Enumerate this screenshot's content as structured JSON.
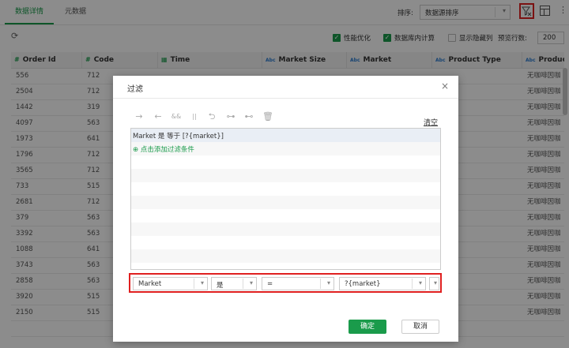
{
  "tabs": [
    {
      "label": "数据详情"
    },
    {
      "label": "元数据"
    }
  ],
  "sort": {
    "label": "排序:",
    "value": "数据源排序"
  },
  "icons": {
    "filter": "filter-icon",
    "layout": "layout-icon",
    "more": "more-icon",
    "refresh": "refresh-icon",
    "close": "close-icon"
  },
  "colors": {
    "accent": "#1a9b4b",
    "highlight": "#e02020",
    "overlay": "rgba(0,0,0,0.45)"
  },
  "options": {
    "perf": {
      "label": "性能优化",
      "checked": true
    },
    "db_calc": {
      "label": "数据库内计算",
      "checked": true
    },
    "show_hidden": {
      "label": "显示隐藏列",
      "checked": false
    },
    "preview_label": "预览行数:",
    "preview_value": "200"
  },
  "table": {
    "columns": [
      {
        "type": "#",
        "name": "Order Id"
      },
      {
        "type": "#",
        "name": "Code"
      },
      {
        "type": "time",
        "name": "Time"
      },
      {
        "type": "Abc",
        "name": "Market Size"
      },
      {
        "type": "Abc",
        "name": "Market"
      },
      {
        "type": "Abc",
        "name": "Product Type"
      },
      {
        "type": "Abc",
        "name": "Product"
      }
    ],
    "rows": [
      [
        "556",
        "712",
        "",
        "",
        "",
        "",
        "无咖啡因咖"
      ],
      [
        "2504",
        "712",
        "",
        "",
        "",
        "",
        "无咖啡因咖"
      ],
      [
        "1442",
        "319",
        "",
        "",
        "",
        "",
        "无咖啡因咖"
      ],
      [
        "4097",
        "563",
        "",
        "",
        "",
        "",
        "无咖啡因咖"
      ],
      [
        "1973",
        "641",
        "",
        "",
        "",
        "",
        "无咖啡因咖"
      ],
      [
        "1796",
        "712",
        "",
        "",
        "",
        "",
        "无咖啡因咖"
      ],
      [
        "3565",
        "712",
        "",
        "",
        "",
        "",
        "无咖啡因咖"
      ],
      [
        "733",
        "515",
        "",
        "",
        "",
        "",
        "无咖啡因咖"
      ],
      [
        "2681",
        "712",
        "",
        "",
        "",
        "",
        "无咖啡因咖"
      ],
      [
        "379",
        "563",
        "",
        "",
        "",
        "",
        "无咖啡因咖"
      ],
      [
        "3392",
        "563",
        "",
        "",
        "",
        "",
        "无咖啡因咖"
      ],
      [
        "1088",
        "641",
        "",
        "",
        "",
        "",
        "无咖啡因咖"
      ],
      [
        "3743",
        "563",
        "",
        "",
        "",
        "",
        "无咖啡因咖"
      ],
      [
        "2858",
        "563",
        "",
        "",
        "",
        "",
        "无咖啡因咖"
      ],
      [
        "3920",
        "515",
        "",
        "",
        "",
        "",
        "无咖啡因咖"
      ],
      [
        "2150",
        "515",
        "",
        "",
        "",
        "",
        "无咖啡因咖"
      ],
      [
        "",
        "",
        "",
        "",
        "",
        "",
        ""
      ]
    ]
  },
  "dialog": {
    "title": "过滤",
    "close_label": "×",
    "toolbar": [
      "arrow-right-icon",
      "arrow-left-icon",
      "and-icon",
      "or-icon",
      "bracket-icon",
      "insert-above-icon",
      "insert-below-icon",
      "delete-icon"
    ],
    "clear_label": "清空",
    "condition_text": "Market 是 等于 [?{market}]",
    "add_condition_label": "⊕ 点击添加过滤条件",
    "editor": {
      "field": "Market",
      "negation": "是",
      "operator": "=",
      "value": "?{market}"
    },
    "ok_label": "确定",
    "cancel_label": "取消"
  }
}
